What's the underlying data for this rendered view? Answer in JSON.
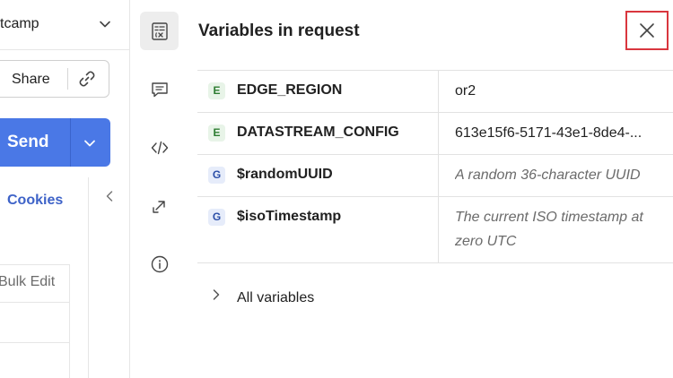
{
  "workspace": {
    "name": "tcamp"
  },
  "request": {
    "share_label": "Share",
    "send_label": "Send",
    "cookies_label": "Cookies",
    "bulk_edit_label": "Bulk Edit"
  },
  "rail": {
    "icons": [
      "variables-icon",
      "comments-icon",
      "code-icon",
      "related-icon",
      "info-icon"
    ],
    "active": "variables-icon"
  },
  "panel": {
    "title": "Variables in request",
    "close_icon": "close-icon",
    "variables": [
      {
        "scope": "E",
        "scope_type": "environment",
        "name": "EDGE_REGION",
        "value": "or2",
        "is_description": false
      },
      {
        "scope": "E",
        "scope_type": "environment",
        "name": "DATASTREAM_CONFIG",
        "value": "613e15f6-5171-43e1-8de4-...",
        "is_description": false
      },
      {
        "scope": "G",
        "scope_type": "global",
        "name": "$randomUUID",
        "value": "A random 36-character UUID",
        "is_description": true
      },
      {
        "scope": "G",
        "scope_type": "global",
        "name": "$isoTimestamp",
        "value": "The current ISO timestamp at zero UTC",
        "is_description": true
      }
    ],
    "all_variables_label": "All variables"
  },
  "colors": {
    "send": "#4a78e6",
    "link": "#3e63c8",
    "close_highlight": "#d9363e",
    "env_badge_text": "#2e7d32",
    "global_badge_text": "#2c4fa8"
  }
}
